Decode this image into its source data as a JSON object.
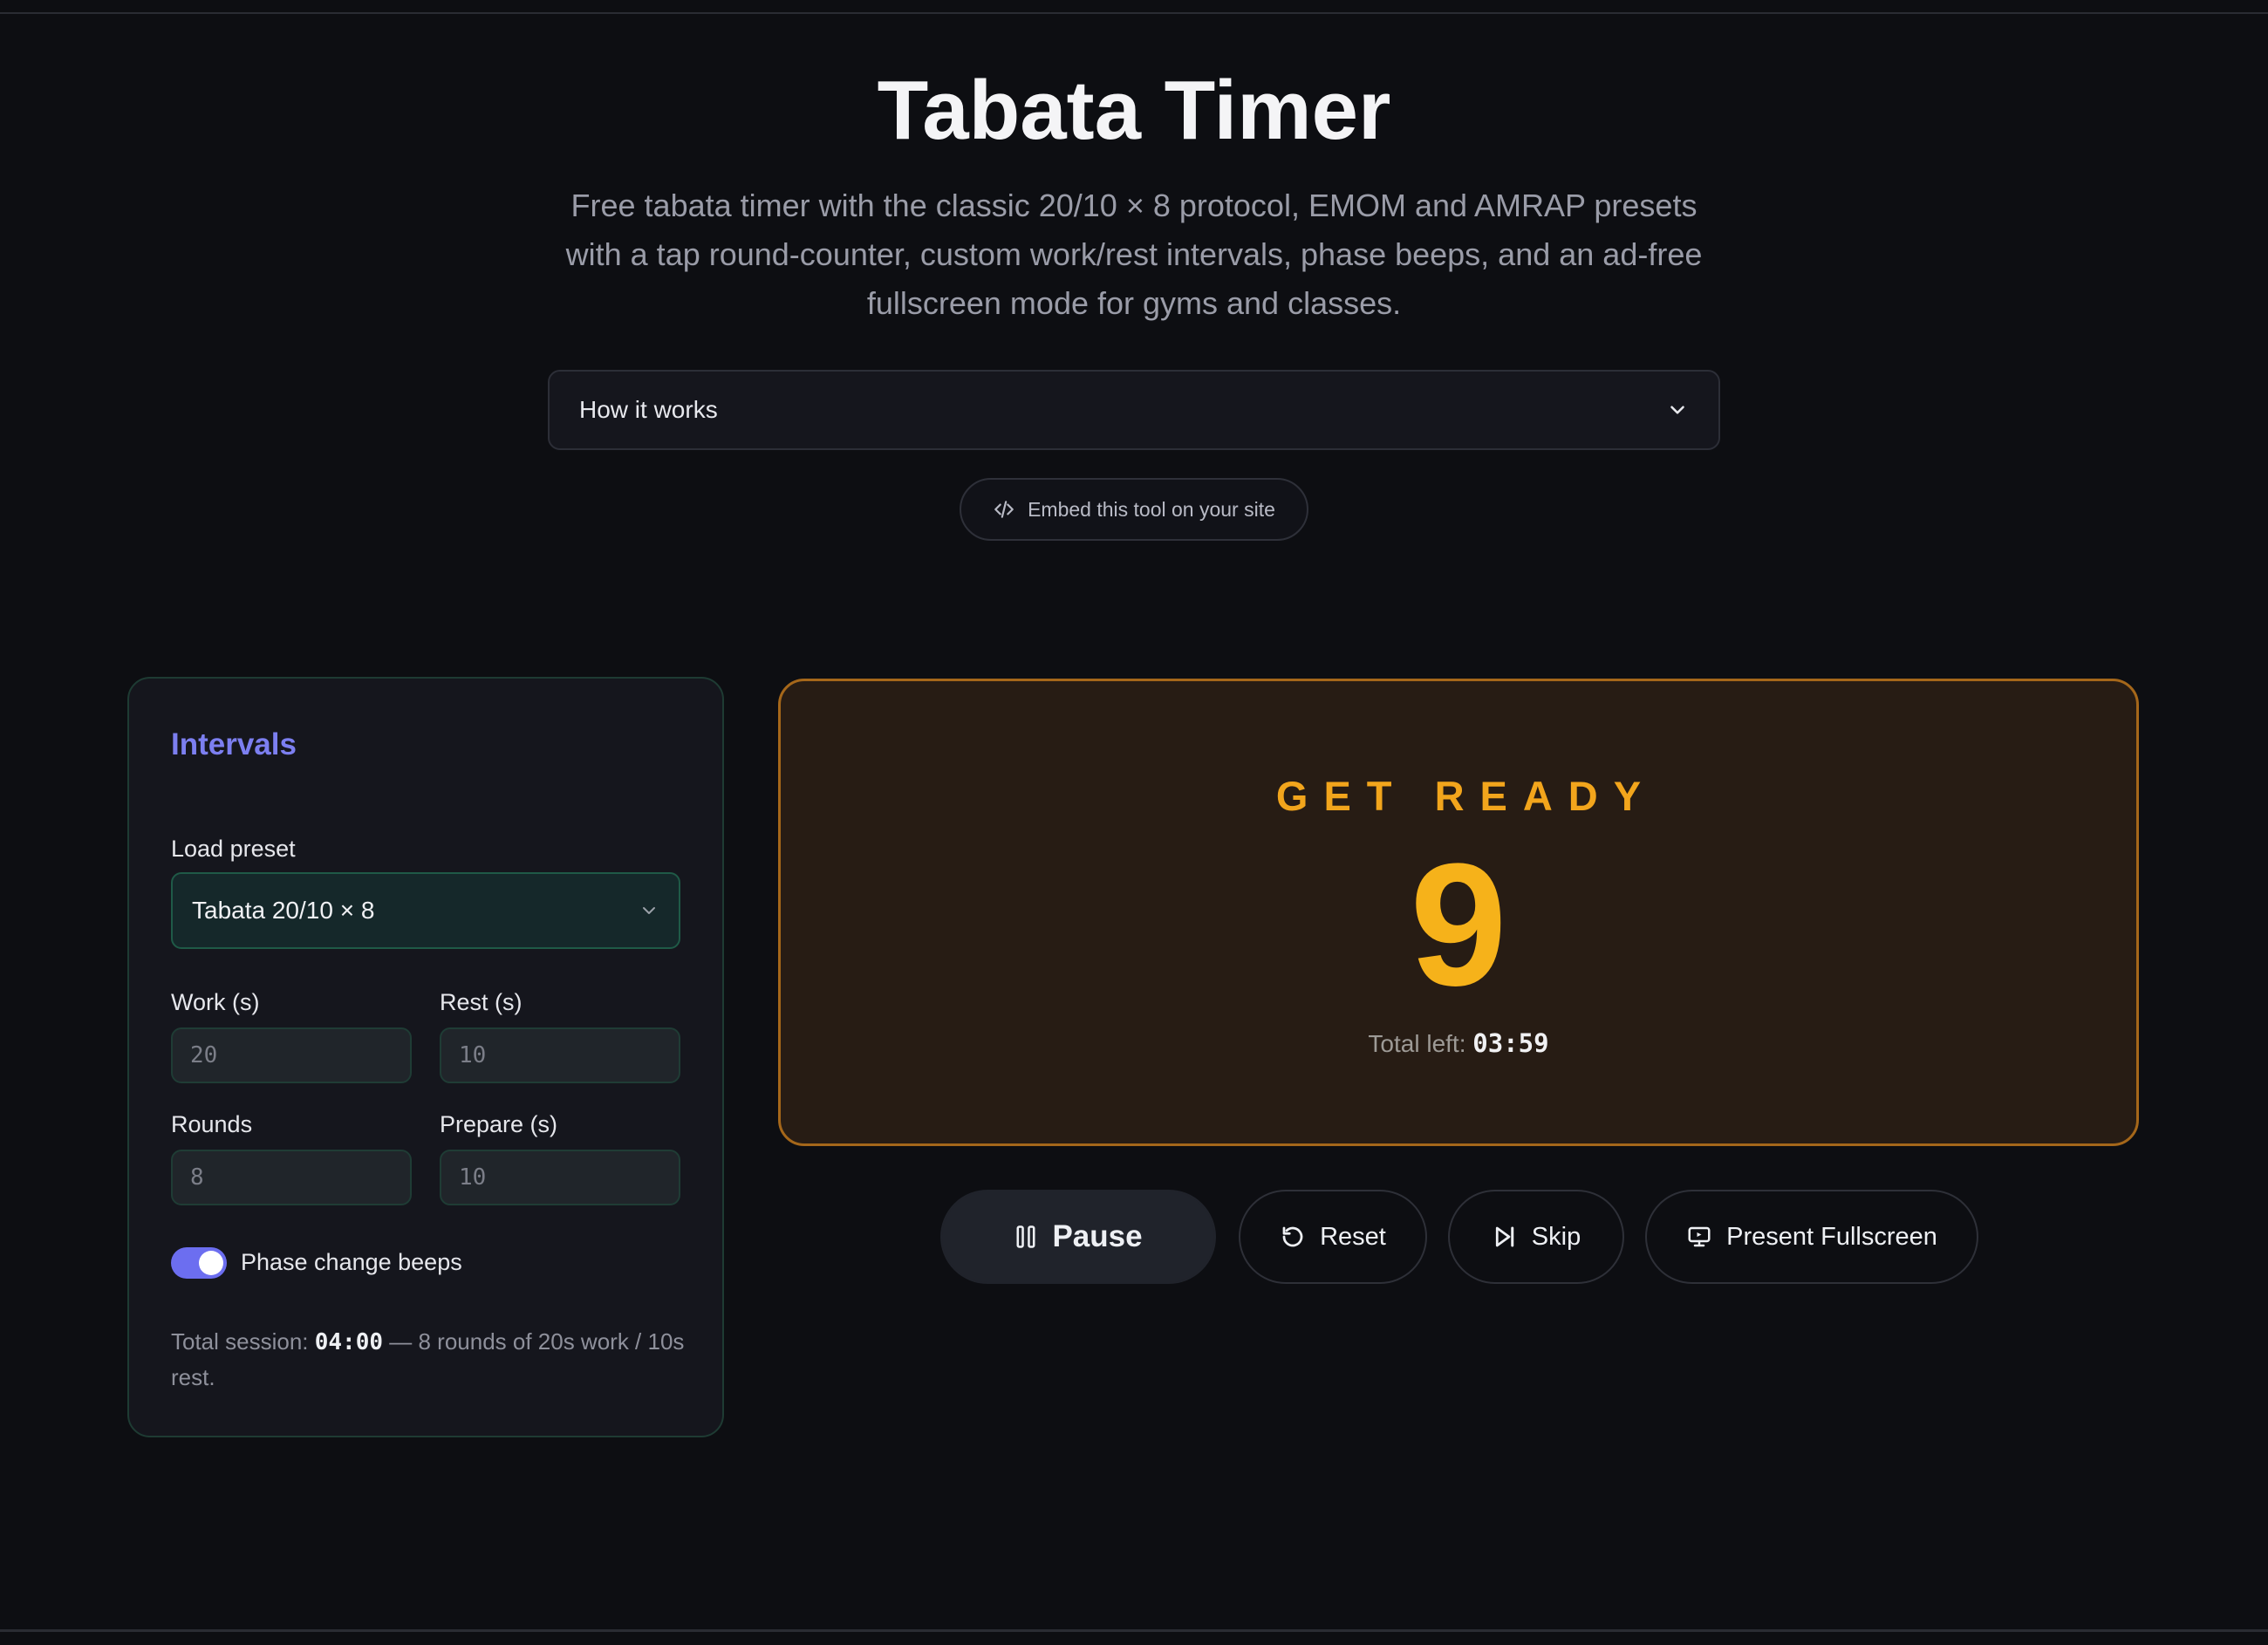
{
  "page": {
    "title": "Tabata Timer",
    "subtitle": "Free tabata timer with the classic 20/10 × 8 protocol, EMOM and AMRAP presets with a tap round-counter, custom work/rest intervals, phase beeps, and an ad-free fullscreen mode for gyms and classes.",
    "how_it_works_label": "How it works",
    "embed_label": "Embed this tool on your site"
  },
  "intervals": {
    "heading": "Intervals",
    "preset_label": "Load preset",
    "preset_value": "Tabata 20/10 × 8",
    "work_label": "Work (s)",
    "work_placeholder": "20",
    "rest_label": "Rest (s)",
    "rest_placeholder": "10",
    "rounds_label": "Rounds",
    "rounds_placeholder": "8",
    "prepare_label": "Prepare (s)",
    "prepare_placeholder": "10",
    "beeps_label": "Phase change beeps",
    "beeps_enabled": true,
    "summary_prefix": "Total session: ",
    "summary_time": "04:00",
    "summary_suffix": " — 8 rounds of 20s work / 10s rest."
  },
  "timer": {
    "phase": "GET READY",
    "count": "9",
    "total_left_label": "Total left: ",
    "total_left_value": "03:59"
  },
  "controls": {
    "pause_label": "Pause",
    "reset_label": "Reset",
    "skip_label": "Skip",
    "fullscreen_label": "Present Fullscreen"
  },
  "colors": {
    "accent": "#6c6ef0",
    "phase_amber": "#f6b21a",
    "background": "#0d0e12"
  }
}
